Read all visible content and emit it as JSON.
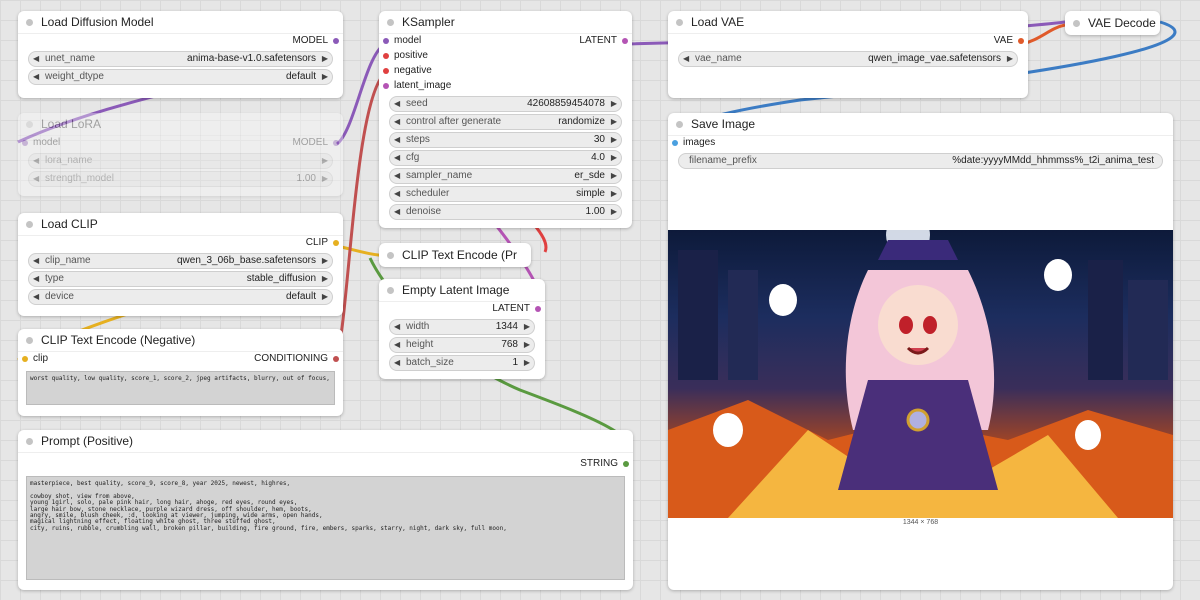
{
  "colors": {
    "model": "#8b5ab8",
    "clip": "#e6b020",
    "conditioning_pos": "#e04040",
    "conditioning_neg": "#c05050",
    "latent": "#b454b4",
    "vae": "#e05a2a",
    "image": "#4aa0e0",
    "string": "#5a9a40",
    "wire_blue": "#3c7cc4"
  },
  "nodes": {
    "load_diffusion": {
      "title": "Load Diffusion Model",
      "output": "MODEL",
      "widgets": [
        {
          "label": "unet_name",
          "value": "anima-base-v1.0.safetensors"
        },
        {
          "label": "weight_dtype",
          "value": "default"
        }
      ]
    },
    "load_lora": {
      "title": "Load LoRA",
      "input": "model",
      "output": "MODEL",
      "widgets": [
        {
          "label": "lora_name",
          "value": ""
        },
        {
          "label": "strength_model",
          "value": "1.00"
        }
      ]
    },
    "load_clip": {
      "title": "Load CLIP",
      "output": "CLIP",
      "widgets": [
        {
          "label": "clip_name",
          "value": "qwen_3_06b_base.safetensors"
        },
        {
          "label": "type",
          "value": "stable_diffusion"
        },
        {
          "label": "device",
          "value": "default"
        }
      ]
    },
    "clip_negative": {
      "title": "CLIP Text Encode (Negative)",
      "input": "clip",
      "output": "CONDITIONING",
      "text": "worst quality, low quality, score_1, score_2, jpeg artifacts, blurry, out of focus,"
    },
    "prompt_positive": {
      "title": "Prompt (Positive)",
      "output": "STRING",
      "text": "masterpiece, best quality, score_9, score_8, year 2025, newest, highres,\n\ncowboy shot, view from above,\nyoung 1girl, solo, pale pink hair, long hair, ahoge, red eyes, round eyes,\nlarge hair bow, stone necklace, purple wizard dress, off shoulder, hem, boots,\nangry, smile, blush cheek, :d, looking at viewer, jumping, wide arms, open hands,\nmagical lightning effect, floating white ghost, three stuffed ghost,\ncity, ruins, rubble, crumbling wall, broken pillar, building, fire ground, fire, embers, sparks, starry, night, dark sky, full moon,"
    },
    "ksampler": {
      "title": "KSampler",
      "inputs": [
        "model",
        "positive",
        "negative",
        "latent_image"
      ],
      "output": "LATENT",
      "widgets": [
        {
          "label": "seed",
          "value": "426088594540​78"
        },
        {
          "label": "control after generate",
          "value": "randomize"
        },
        {
          "label": "steps",
          "value": "30"
        },
        {
          "label": "cfg",
          "value": "4.0"
        },
        {
          "label": "sampler_name",
          "value": "er_sde"
        },
        {
          "label": "scheduler",
          "value": "simple"
        },
        {
          "label": "denoise",
          "value": "1.00"
        }
      ]
    },
    "clip_encode_pr": {
      "title": "CLIP Text Encode (Pr"
    },
    "empty_latent": {
      "title": "Empty Latent Image",
      "output": "LATENT",
      "widgets": [
        {
          "label": "width",
          "value": "1344"
        },
        {
          "label": "height",
          "value": "768"
        },
        {
          "label": "batch_size",
          "value": "1"
        }
      ]
    },
    "load_vae": {
      "title": "Load VAE",
      "output": "VAE",
      "widgets": [
        {
          "label": "vae_name",
          "value": "qwen_image_vae.safetensors"
        }
      ]
    },
    "vae_decode": {
      "title": "VAE Decode"
    },
    "save_image": {
      "title": "Save Image",
      "input": "images",
      "widgets": [
        {
          "label": "filename_prefix",
          "value": "%date:yyyyMMdd_hhmmss%_t2i_anima_test"
        }
      ],
      "preview_caption": "1344 × 768"
    }
  }
}
